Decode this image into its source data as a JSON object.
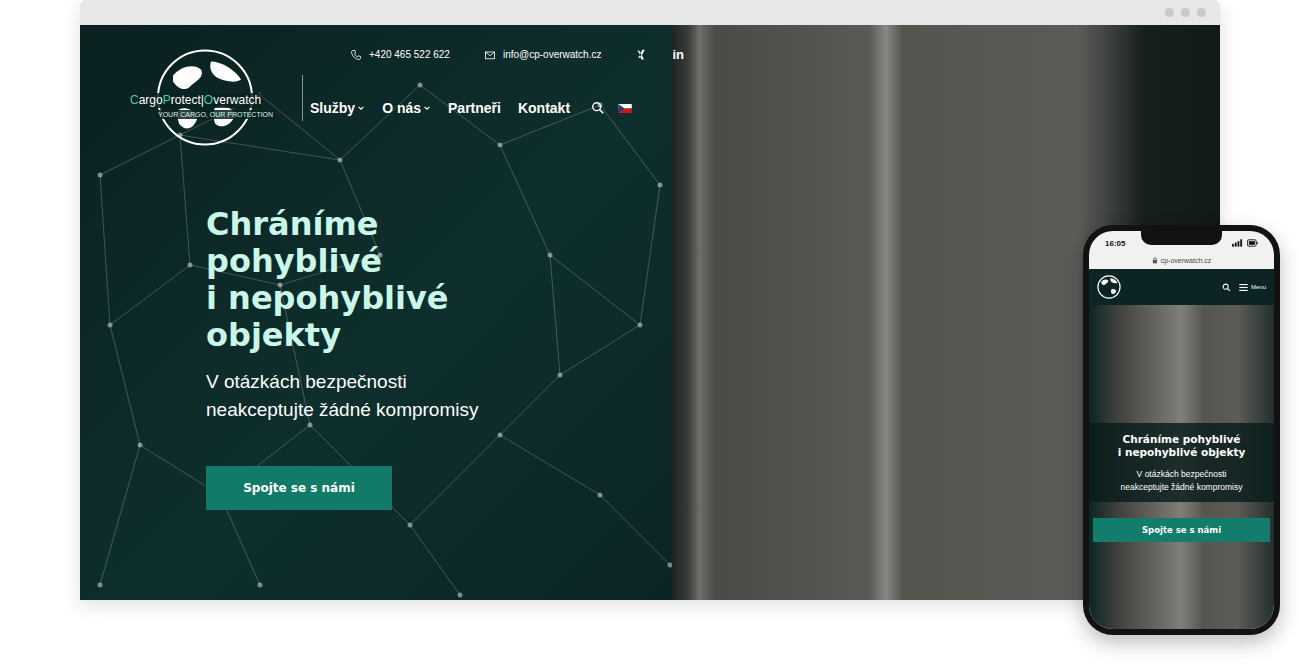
{
  "header": {
    "phone": "+420 465 522 622",
    "email": "info@cp-overwatch.cz",
    "linkedin": "in"
  },
  "logo": {
    "parts": [
      {
        "text": "C",
        "accent": true
      },
      {
        "text": "argo",
        "accent": false
      },
      {
        "text": "P",
        "accent": true
      },
      {
        "text": "rotect|",
        "accent": false
      },
      {
        "text": "O",
        "accent": true
      },
      {
        "text": "verwatch",
        "accent": false
      }
    ],
    "tagline": "YOUR CARGO, OUR PROTECTION"
  },
  "nav": [
    {
      "label": "Služby",
      "dropdown": true
    },
    {
      "label": "O nás",
      "dropdown": true
    },
    {
      "label": "Partneři",
      "dropdown": false
    },
    {
      "label": "Kontakt",
      "dropdown": false
    }
  ],
  "hero": {
    "title_lines": [
      "Chráníme",
      "pohyblivé",
      "i nepohyblivé",
      "objekty"
    ],
    "subtitle_lines": [
      "V otázkách bezpečnosti",
      "neakceptujte žádné kompromisy"
    ],
    "button": "Spojte se s námi"
  },
  "phone": {
    "time": "16:05",
    "url": "cp-overwatch.cz",
    "menu": "Menu",
    "title_lines": [
      "Chráníme pohyblivé",
      "i nepohyblivé objekty"
    ],
    "subtitle_lines": [
      "V otázkách bezpečnosti",
      "neakceptujte žádné kompromisy"
    ],
    "button": "Spojte se s námi"
  }
}
